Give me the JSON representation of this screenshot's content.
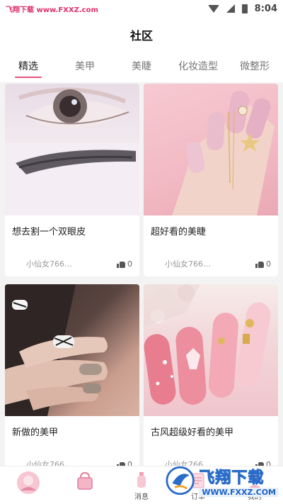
{
  "status": {
    "left_text": "飞翔下载 www.FXXZ.com",
    "time": "8:04"
  },
  "header": {
    "title": "社区"
  },
  "tabs": [
    {
      "label": "精选",
      "active": true
    },
    {
      "label": "美甲",
      "active": false
    },
    {
      "label": "美睫",
      "active": false
    },
    {
      "label": "化妆造型",
      "active": false
    },
    {
      "label": "微整形",
      "active": false
    }
  ],
  "posts": [
    {
      "title": "想去割一个双眼皮",
      "author": "小仙女766…",
      "likes": "0",
      "image": "eye-closeup"
    },
    {
      "title": "超好看的美睫",
      "author": "小仙女766…",
      "likes": "0",
      "image": "pink-nails"
    },
    {
      "title": "新做的美甲",
      "author": "小仙女766…",
      "likes": "0",
      "image": "hand-nails"
    },
    {
      "title": "古风超级好看的美甲",
      "author": "小仙女766…",
      "likes": "0",
      "image": "nail-art"
    }
  ],
  "bottom_nav": [
    {
      "label": "",
      "icon": "avatar-icon"
    },
    {
      "label": "",
      "icon": "bag-icon"
    },
    {
      "label": "消息",
      "icon": "bottle-icon"
    },
    {
      "label": "订单",
      "icon": "order-icon"
    },
    {
      "label": "我的",
      "icon": "user-icon"
    }
  ],
  "watermark": {
    "big": "飞翔下载",
    "url": "WWW.FXXZ.COM"
  },
  "colors": {
    "accent": "#e3557d",
    "background": "#f3f3f3"
  }
}
